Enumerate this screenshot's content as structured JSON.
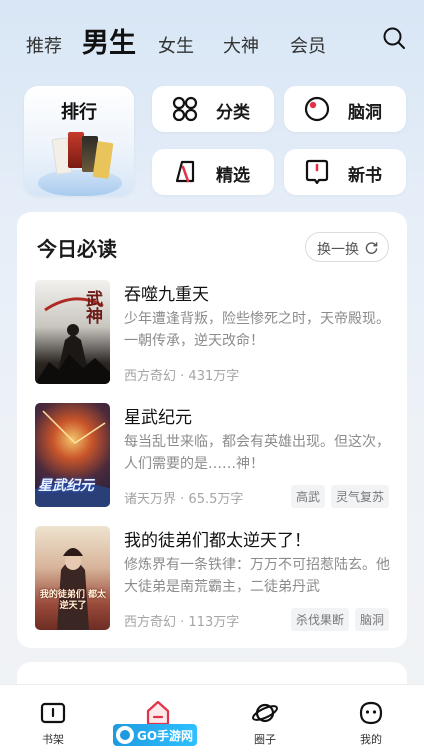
{
  "top_tabs": [
    "推荐",
    "男生",
    "女生",
    "大神",
    "会员"
  ],
  "active_tab": "男生",
  "ranking_card": {
    "label": "排行"
  },
  "quick_links": [
    {
      "label": "分类",
      "icon": "category-grid-icon"
    },
    {
      "label": "脑洞",
      "icon": "brain-hole-icon"
    },
    {
      "label": "精选",
      "icon": "featured-icon"
    },
    {
      "label": "新书",
      "icon": "new-book-icon"
    }
  ],
  "section": {
    "title": "今日必读",
    "refresh_label": "换一换",
    "books": [
      {
        "title": "吞噬九重天",
        "description": "少年遭逢背叛，险些惨死之时，天帝殿现。一朝传承，逆天改命！",
        "genre": "西方奇幻",
        "words": "431万字",
        "tags": [],
        "cover_text": "武神"
      },
      {
        "title": "星武纪元",
        "description": "每当乱世来临，都会有英雄出现。但这次，人们需要的是……神！",
        "genre": "诸天万界",
        "words": "65.5万字",
        "tags": [
          "高武",
          "灵气复苏"
        ],
        "cover_text": "星武纪元"
      },
      {
        "title": "我的徒弟们都太逆天了！",
        "description": "修炼界有一条铁律：万万不可招惹陆玄。他大徒弟是南荒霸主，二徒弟丹武",
        "genre": "西方奇幻",
        "words": "113万字",
        "tags": [
          "杀伐果断",
          "脑洞"
        ],
        "cover_text": "我的徒弟们 都太逆天了"
      }
    ]
  },
  "bottom_nav": [
    {
      "label": "书架",
      "icon": "bookshelf-icon"
    },
    {
      "label": "",
      "icon": "bookstore-icon"
    },
    {
      "label": "圈子",
      "icon": "planet-icon"
    },
    {
      "label": "我的",
      "icon": "profile-icon"
    }
  ],
  "watermark": "GO手游网",
  "colors": {
    "accent": "#e0334a",
    "muted": "#8c8c8c"
  }
}
